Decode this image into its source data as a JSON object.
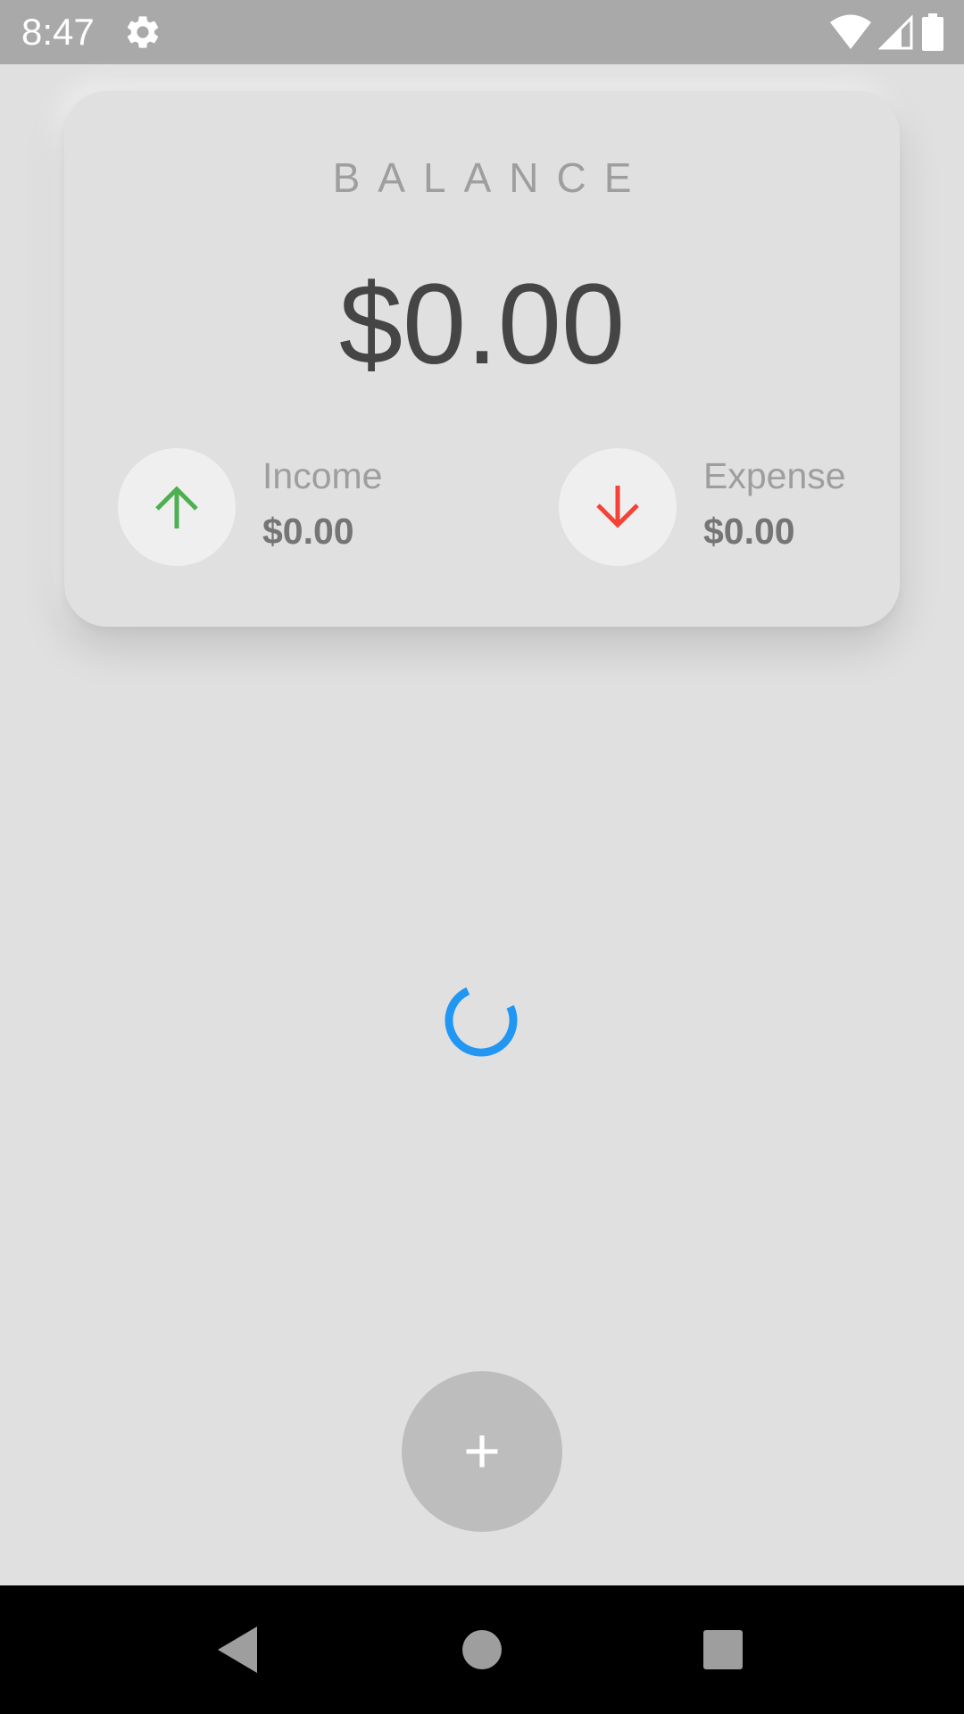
{
  "status_bar": {
    "time": "8:47",
    "icons": [
      "gear-icon",
      "wifi-icon",
      "cell-signal-icon",
      "battery-icon"
    ]
  },
  "balance_card": {
    "label": "BALANCE",
    "amount": "$0.00",
    "income": {
      "label": "Income",
      "value": "$0.00",
      "icon": "arrow-up-icon",
      "color": "#4caf50"
    },
    "expense": {
      "label": "Expense",
      "value": "$0.00",
      "icon": "arrow-down-icon",
      "color": "#f44336"
    }
  },
  "loading": {
    "icon": "loading-spinner",
    "color": "#2196f3"
  },
  "fab": {
    "icon": "plus-icon",
    "symbol": "+"
  },
  "nav_bar": {
    "icons": [
      "back-icon",
      "home-icon",
      "recents-icon"
    ]
  }
}
